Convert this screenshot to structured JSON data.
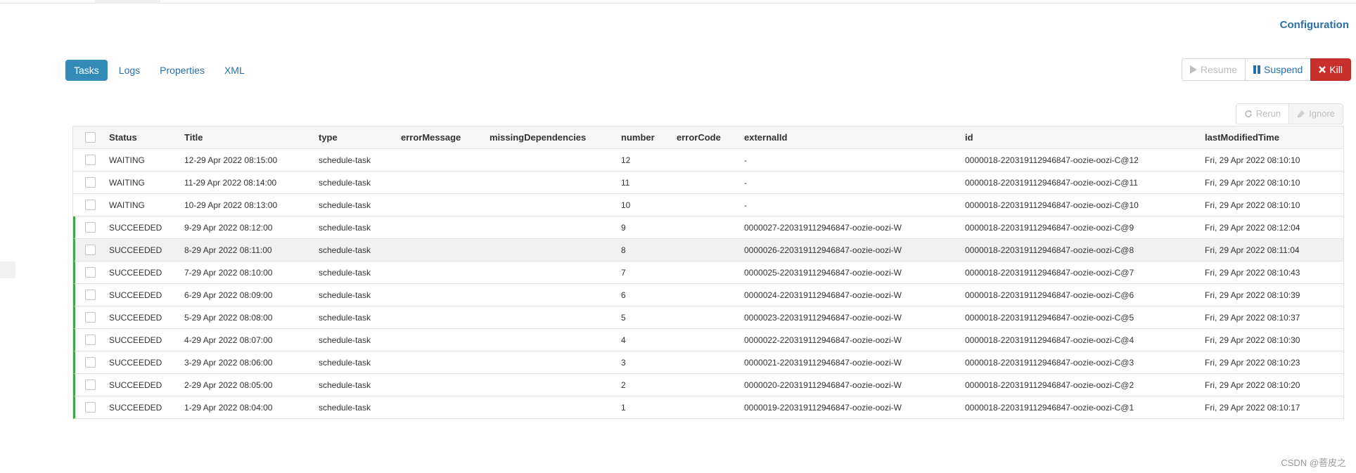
{
  "header": {
    "configuration_link": "Configuration"
  },
  "tabs": [
    {
      "label": "Tasks",
      "active": true
    },
    {
      "label": "Logs",
      "active": false
    },
    {
      "label": "Properties",
      "active": false
    },
    {
      "label": "XML",
      "active": false
    }
  ],
  "actions": {
    "resume": {
      "label": "Resume",
      "icon": "play-icon",
      "enabled": false
    },
    "suspend": {
      "label": "Suspend",
      "icon": "pause-icon",
      "enabled": true
    },
    "kill": {
      "label": "Kill",
      "icon": "x-icon",
      "enabled": true
    }
  },
  "table_actions": {
    "rerun": {
      "label": "Rerun",
      "icon": "refresh-icon",
      "enabled": false
    },
    "ignore": {
      "label": "Ignore",
      "icon": "eraser-icon",
      "enabled": false
    }
  },
  "table": {
    "columns": [
      "Status",
      "Title",
      "type",
      "errorMessage",
      "missingDependencies",
      "number",
      "errorCode",
      "externalId",
      "id",
      "lastModifiedTime"
    ],
    "rows": [
      {
        "status": "WAITING",
        "title": "12-29 Apr 2022 08:15:00",
        "type": "schedule-task",
        "errorMessage": "",
        "missingDependencies": "",
        "number": "12",
        "errorCode": "",
        "externalId": "-",
        "id": "0000018-220319112946847-oozie-oozi-C@12",
        "lastModifiedTime": "Fri, 29 Apr 2022 08:10:10"
      },
      {
        "status": "WAITING",
        "title": "11-29 Apr 2022 08:14:00",
        "type": "schedule-task",
        "errorMessage": "",
        "missingDependencies": "",
        "number": "11",
        "errorCode": "",
        "externalId": "-",
        "id": "0000018-220319112946847-oozie-oozi-C@11",
        "lastModifiedTime": "Fri, 29 Apr 2022 08:10:10"
      },
      {
        "status": "WAITING",
        "title": "10-29 Apr 2022 08:13:00",
        "type": "schedule-task",
        "errorMessage": "",
        "missingDependencies": "",
        "number": "10",
        "errorCode": "",
        "externalId": "-",
        "id": "0000018-220319112946847-oozie-oozi-C@10",
        "lastModifiedTime": "Fri, 29 Apr 2022 08:10:10"
      },
      {
        "status": "SUCCEEDED",
        "title": "9-29 Apr 2022 08:12:00",
        "type": "schedule-task",
        "errorMessage": "",
        "missingDependencies": "",
        "number": "9",
        "errorCode": "",
        "externalId": "0000027-220319112946847-oozie-oozi-W",
        "id": "0000018-220319112946847-oozie-oozi-C@9",
        "lastModifiedTime": "Fri, 29 Apr 2022 08:12:04"
      },
      {
        "status": "SUCCEEDED",
        "title": "8-29 Apr 2022 08:11:00",
        "type": "schedule-task",
        "errorMessage": "",
        "missingDependencies": "",
        "number": "8",
        "errorCode": "",
        "externalId": "0000026-220319112946847-oozie-oozi-W",
        "id": "0000018-220319112946847-oozie-oozi-C@8",
        "lastModifiedTime": "Fri, 29 Apr 2022 08:11:04"
      },
      {
        "status": "SUCCEEDED",
        "title": "7-29 Apr 2022 08:10:00",
        "type": "schedule-task",
        "errorMessage": "",
        "missingDependencies": "",
        "number": "7",
        "errorCode": "",
        "externalId": "0000025-220319112946847-oozie-oozi-W",
        "id": "0000018-220319112946847-oozie-oozi-C@7",
        "lastModifiedTime": "Fri, 29 Apr 2022 08:10:43"
      },
      {
        "status": "SUCCEEDED",
        "title": "6-29 Apr 2022 08:09:00",
        "type": "schedule-task",
        "errorMessage": "",
        "missingDependencies": "",
        "number": "6",
        "errorCode": "",
        "externalId": "0000024-220319112946847-oozie-oozi-W",
        "id": "0000018-220319112946847-oozie-oozi-C@6",
        "lastModifiedTime": "Fri, 29 Apr 2022 08:10:39"
      },
      {
        "status": "SUCCEEDED",
        "title": "5-29 Apr 2022 08:08:00",
        "type": "schedule-task",
        "errorMessage": "",
        "missingDependencies": "",
        "number": "5",
        "errorCode": "",
        "externalId": "0000023-220319112946847-oozie-oozi-W",
        "id": "0000018-220319112946847-oozie-oozi-C@5",
        "lastModifiedTime": "Fri, 29 Apr 2022 08:10:37"
      },
      {
        "status": "SUCCEEDED",
        "title": "4-29 Apr 2022 08:07:00",
        "type": "schedule-task",
        "errorMessage": "",
        "missingDependencies": "",
        "number": "4",
        "errorCode": "",
        "externalId": "0000022-220319112946847-oozie-oozi-W",
        "id": "0000018-220319112946847-oozie-oozi-C@4",
        "lastModifiedTime": "Fri, 29 Apr 2022 08:10:30"
      },
      {
        "status": "SUCCEEDED",
        "title": "3-29 Apr 2022 08:06:00",
        "type": "schedule-task",
        "errorMessage": "",
        "missingDependencies": "",
        "number": "3",
        "errorCode": "",
        "externalId": "0000021-220319112946847-oozie-oozi-W",
        "id": "0000018-220319112946847-oozie-oozi-C@3",
        "lastModifiedTime": "Fri, 29 Apr 2022 08:10:23"
      },
      {
        "status": "SUCCEEDED",
        "title": "2-29 Apr 2022 08:05:00",
        "type": "schedule-task",
        "errorMessage": "",
        "missingDependencies": "",
        "number": "2",
        "errorCode": "",
        "externalId": "0000020-220319112946847-oozie-oozi-W",
        "id": "0000018-220319112946847-oozie-oozi-C@2",
        "lastModifiedTime": "Fri, 29 Apr 2022 08:10:20"
      },
      {
        "status": "SUCCEEDED",
        "title": "1-29 Apr 2022 08:04:00",
        "type": "schedule-task",
        "errorMessage": "",
        "missingDependencies": "",
        "number": "1",
        "errorCode": "",
        "externalId": "0000019-220319112946847-oozie-oozi-W",
        "id": "0000018-220319112946847-oozie-oozi-C@1",
        "lastModifiedTime": "Fri, 29 Apr 2022 08:10:17"
      }
    ]
  },
  "colors": {
    "accent": "#338bb8",
    "link": "#2b6fa6",
    "danger": "#c9302c",
    "succeeded": "#3fa84c"
  },
  "watermark": "CSDN @菩皮之"
}
